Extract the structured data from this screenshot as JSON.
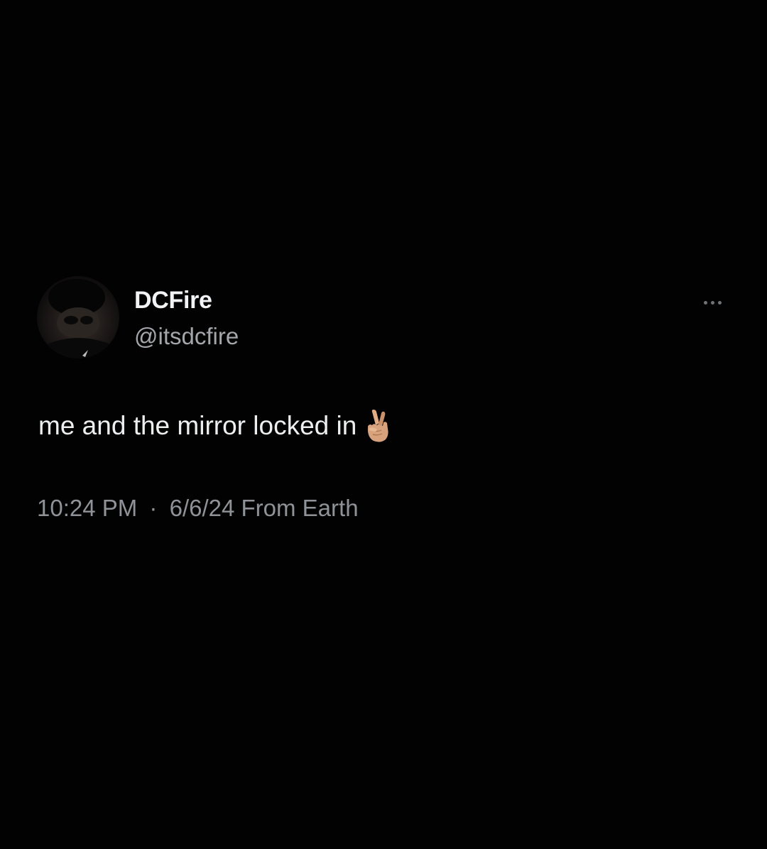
{
  "tweet": {
    "author": {
      "display_name": "DCFire",
      "handle": "@itsdcfire",
      "avatar_icon": "profile-avatar"
    },
    "more_icon": "more-options-icon",
    "text": "me and the mirror locked in",
    "emoji": "🤞🏼",
    "emoji_icon": "crossed-fingers-icon",
    "time": "10:24 PM",
    "separator": "·",
    "date": "6/6/24",
    "source": "From Earth"
  },
  "colors": {
    "background": "#020202",
    "primary_text": "#eceeef",
    "secondary_text": "#8f9398"
  }
}
